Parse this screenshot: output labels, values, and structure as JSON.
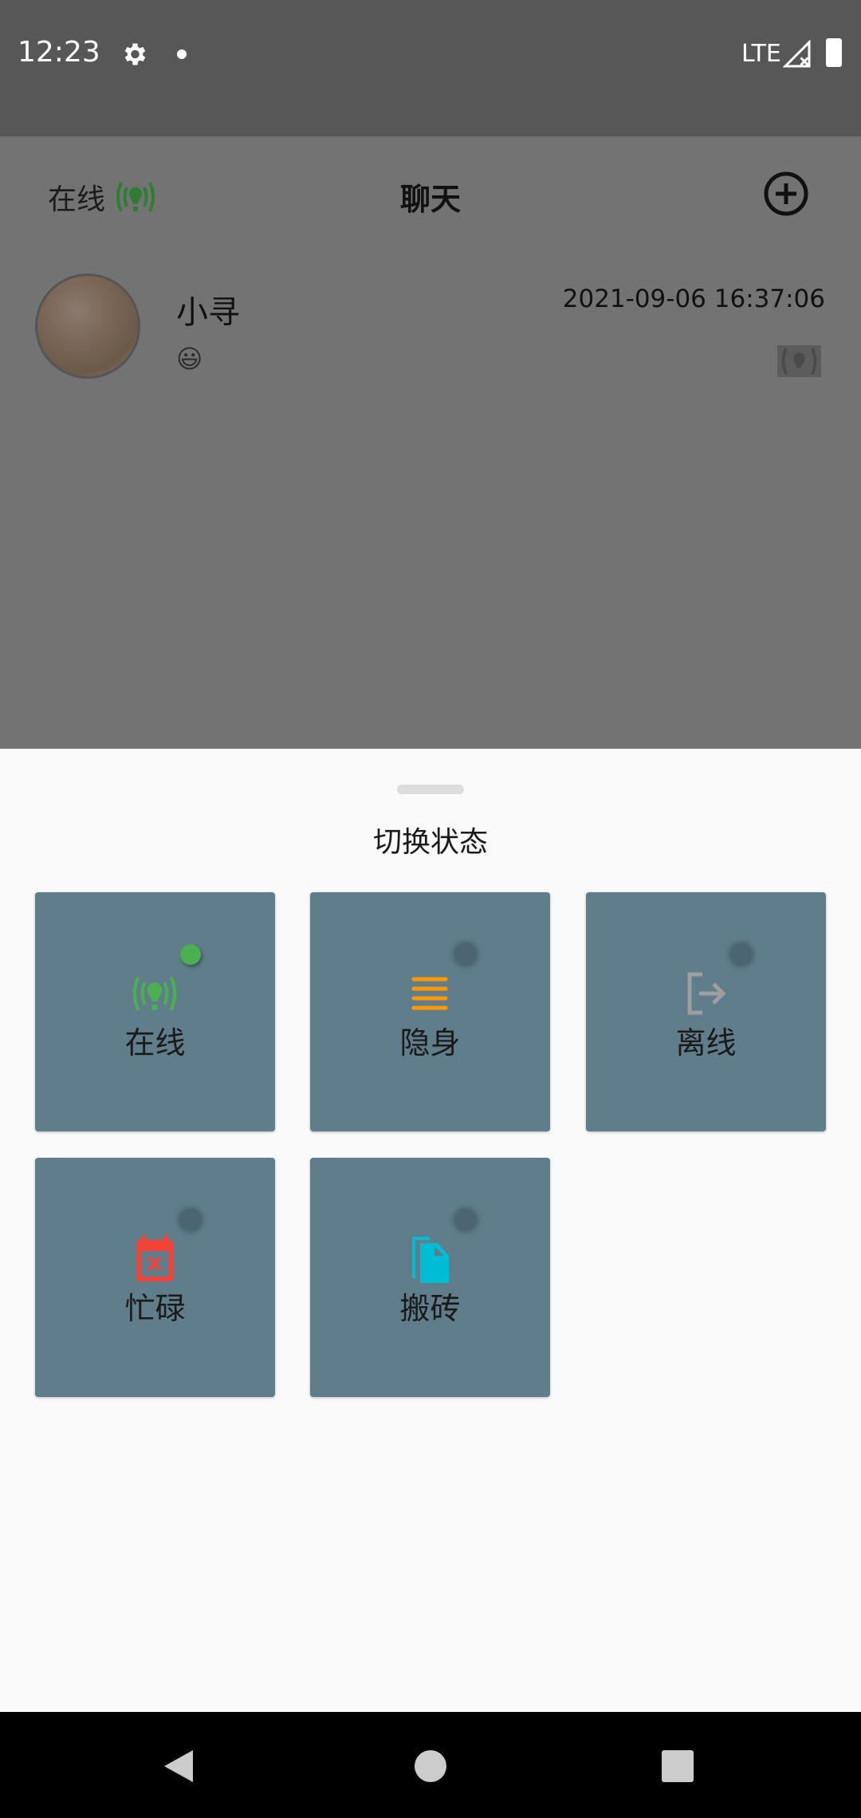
{
  "status_bar": {
    "time": "12:23",
    "network": "LTE"
  },
  "header": {
    "status_label": "在线",
    "title": "聊天"
  },
  "chat_list": [
    {
      "name": "小寻",
      "timestamp": "2021-09-06 16:37:06",
      "preview_emoji": "😃"
    }
  ],
  "sheet": {
    "title": "切换状态",
    "options": [
      {
        "label": "在线",
        "icon": "broadcast-icon",
        "color": "#4caf50",
        "selected": true
      },
      {
        "label": "隐身",
        "icon": "menu-lines-icon",
        "color": "#ff9800",
        "selected": false
      },
      {
        "label": "离线",
        "icon": "logout-icon",
        "color": "#9e9e9e",
        "selected": false
      },
      {
        "label": "忙碌",
        "icon": "calendar-x-icon",
        "color": "#f44336",
        "selected": false
      },
      {
        "label": "搬砖",
        "icon": "copy-icon",
        "color": "#00bcd4",
        "selected": false
      }
    ]
  }
}
